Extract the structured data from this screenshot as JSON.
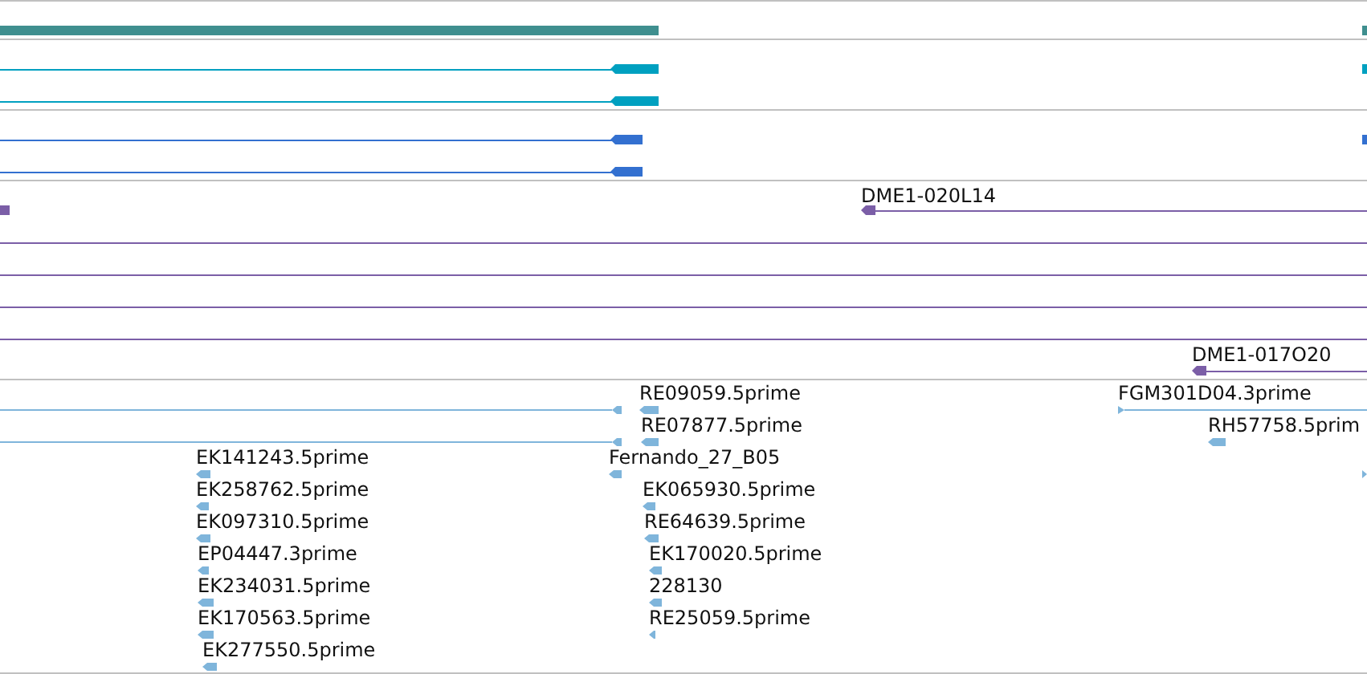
{
  "tracks": [
    {
      "kind": "bar",
      "color": "#3f8f8f"
    },
    {
      "kind": "transcripts",
      "color": "#00a0c0"
    },
    {
      "kind": "transcripts",
      "color": "#3370d0"
    },
    {
      "kind": "clones",
      "color": "#7b5ea7",
      "features": [
        {
          "label": "DME1-020L14"
        },
        {
          "label": "DME1-017O20"
        }
      ]
    },
    {
      "kind": "ests",
      "color": "#7fb5db",
      "features": [
        {
          "label": "RE09059.5prime"
        },
        {
          "label": "FGM301D04.3prime"
        },
        {
          "label": "RE07877.5prime"
        },
        {
          "label": "RH57758.5prim"
        },
        {
          "label": "EK141243.5prime"
        },
        {
          "label": "Fernando_27_B05"
        },
        {
          "label": "EK258762.5prime"
        },
        {
          "label": "EK065930.5prime"
        },
        {
          "label": "EK097310.5prime"
        },
        {
          "label": "RE64639.5prime"
        },
        {
          "label": "EP04447.3prime"
        },
        {
          "label": "EK170020.5prime"
        },
        {
          "label": "EK234031.5prime"
        },
        {
          "label": "228130"
        },
        {
          "label": "EK170563.5prime"
        },
        {
          "label": "RE25059.5prime"
        },
        {
          "label": "EK277550.5prime"
        }
      ]
    }
  ]
}
